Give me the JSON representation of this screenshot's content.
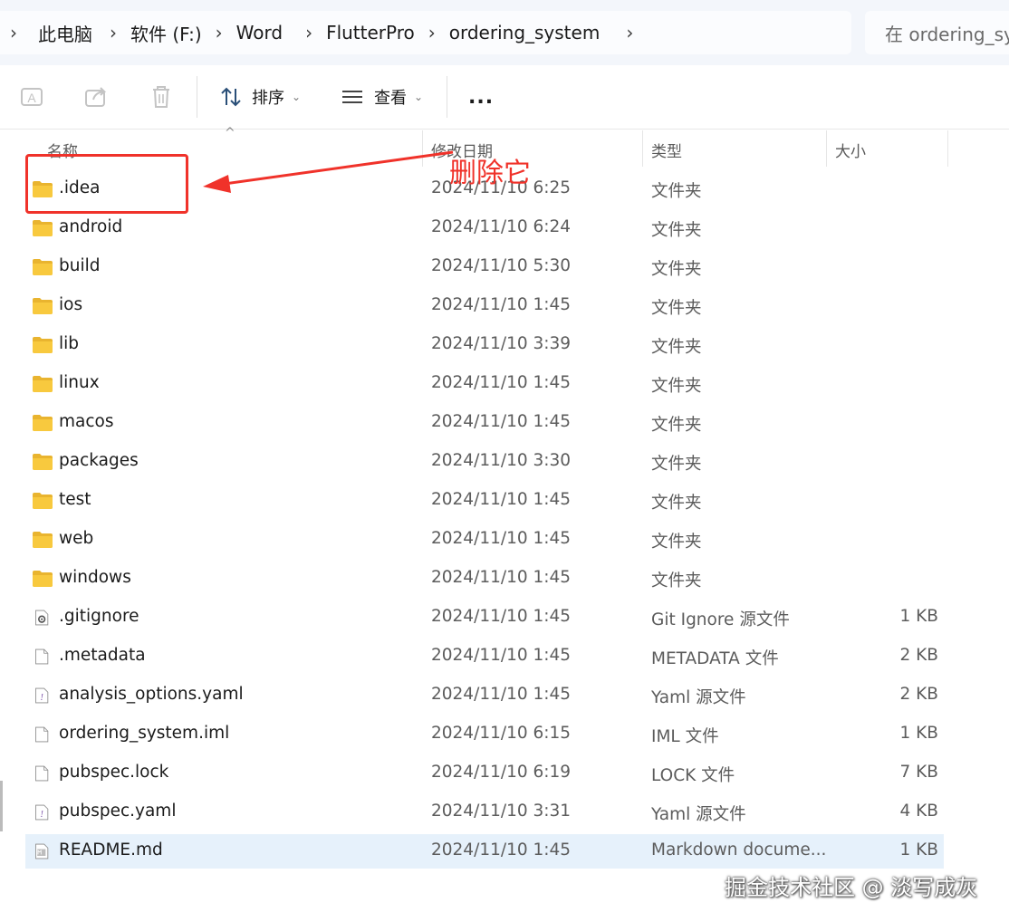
{
  "breadcrumb": {
    "items": [
      "此电脑",
      "软件 (F:)",
      "Word",
      "FlutterPro",
      "ordering_system"
    ]
  },
  "search": {
    "placeholder": "在 ordering_system 中搜索"
  },
  "toolbar": {
    "sort_label": "排序",
    "view_label": "查看",
    "more_label": "..."
  },
  "columns": {
    "name": "名称",
    "modified": "修改日期",
    "type": "类型",
    "size": "大小"
  },
  "files": [
    {
      "name": ".idea",
      "date": "2024/11/10 6:25",
      "type": "文件夹",
      "size": "",
      "icon": "folder-icon"
    },
    {
      "name": "android",
      "date": "2024/11/10 6:24",
      "type": "文件夹",
      "size": "",
      "icon": "folder-icon"
    },
    {
      "name": "build",
      "date": "2024/11/10 5:30",
      "type": "文件夹",
      "size": "",
      "icon": "folder-icon"
    },
    {
      "name": "ios",
      "date": "2024/11/10 1:45",
      "type": "文件夹",
      "size": "",
      "icon": "folder-icon"
    },
    {
      "name": "lib",
      "date": "2024/11/10 3:39",
      "type": "文件夹",
      "size": "",
      "icon": "folder-icon"
    },
    {
      "name": "linux",
      "date": "2024/11/10 1:45",
      "type": "文件夹",
      "size": "",
      "icon": "folder-icon"
    },
    {
      "name": "macos",
      "date": "2024/11/10 1:45",
      "type": "文件夹",
      "size": "",
      "icon": "folder-icon"
    },
    {
      "name": "packages",
      "date": "2024/11/10 3:30",
      "type": "文件夹",
      "size": "",
      "icon": "folder-icon"
    },
    {
      "name": "test",
      "date": "2024/11/10 1:45",
      "type": "文件夹",
      "size": "",
      "icon": "folder-icon"
    },
    {
      "name": "web",
      "date": "2024/11/10 1:45",
      "type": "文件夹",
      "size": "",
      "icon": "folder-icon"
    },
    {
      "name": "windows",
      "date": "2024/11/10 1:45",
      "type": "文件夹",
      "size": "",
      "icon": "folder-icon"
    },
    {
      "name": ".gitignore",
      "date": "2024/11/10 1:45",
      "type": "Git Ignore 源文件",
      "size": "1 KB",
      "icon": "gear-file-icon"
    },
    {
      "name": ".metadata",
      "date": "2024/11/10 1:45",
      "type": "METADATA 文件",
      "size": "2 KB",
      "icon": "file-icon"
    },
    {
      "name": "analysis_options.yaml",
      "date": "2024/11/10 1:45",
      "type": "Yaml 源文件",
      "size": "2 KB",
      "icon": "yaml-file-icon"
    },
    {
      "name": "ordering_system.iml",
      "date": "2024/11/10 6:15",
      "type": "IML 文件",
      "size": "1 KB",
      "icon": "file-icon"
    },
    {
      "name": "pubspec.lock",
      "date": "2024/11/10 6:19",
      "type": "LOCK 文件",
      "size": "7 KB",
      "icon": "file-icon"
    },
    {
      "name": "pubspec.yaml",
      "date": "2024/11/10 3:31",
      "type": "Yaml 源文件",
      "size": "4 KB",
      "icon": "yaml-file-icon"
    },
    {
      "name": "README.md",
      "date": "2024/11/10 1:45",
      "type": "Markdown docume...",
      "size": "1 KB",
      "icon": "markdown-file-icon",
      "selected": true
    }
  ],
  "annotation": {
    "label": "删除它",
    "color": "#f0322a"
  },
  "watermark": "掘金技术社区 @ 淡写成灰",
  "colors": {
    "selection": "#e6f1fb",
    "folder": "#f8c93e",
    "annotation": "#f0322a"
  }
}
